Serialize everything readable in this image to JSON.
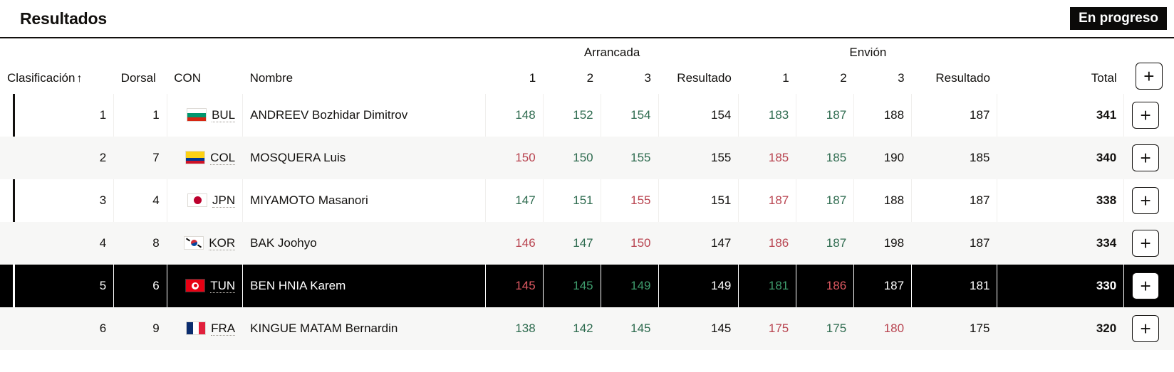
{
  "header": {
    "title": "Resultados",
    "status_badge": "En progreso",
    "badge_bg": "#0b0a09",
    "badge_fg": "#ffffff"
  },
  "table": {
    "groups": {
      "snatch": "Arrancada",
      "cleanjerk": "Envión",
      "total": "Total"
    },
    "columns": {
      "rank": "Clasificación",
      "sort_arrow": "↑",
      "bib": "Dorsal",
      "noc": "CON",
      "name": "Nombre",
      "a1": "1",
      "a2": "2",
      "a3": "3",
      "a_result": "Resultado",
      "c1": "1",
      "c2": "2",
      "c3": "3",
      "c_result": "Resultado",
      "total": "Total",
      "expand": "+"
    },
    "colors": {
      "good": "#2e6b4f",
      "bad": "#b8434f",
      "neutral": "#12100e",
      "selected_bg": "#000000",
      "row_alt_bg": "#f7f7f6"
    },
    "rows": [
      {
        "rank": "1",
        "bib": "1",
        "noc": "BUL",
        "flag": "flag-bulgaria",
        "name": "ANDREEV Bozhidar Dimitrov",
        "a1": "148",
        "a1_state": "good",
        "a2": "152",
        "a2_state": "good",
        "a3": "154",
        "a3_state": "good",
        "a_result": "154",
        "c1": "183",
        "c1_state": "good",
        "c2": "187",
        "c2_state": "good",
        "c3": "188",
        "c3_state": "pending",
        "c_result": "187",
        "total": "341",
        "expand": "+",
        "selected": false,
        "accent": true
      },
      {
        "rank": "2",
        "bib": "7",
        "noc": "COL",
        "flag": "flag-colombia",
        "name": "MOSQUERA Luis",
        "a1": "150",
        "a1_state": "bad",
        "a2": "150",
        "a2_state": "good",
        "a3": "155",
        "a3_state": "good",
        "a_result": "155",
        "c1": "185",
        "c1_state": "bad",
        "c2": "185",
        "c2_state": "good",
        "c3": "190",
        "c3_state": "pending",
        "c_result": "185",
        "total": "340",
        "expand": "+",
        "selected": false,
        "accent": false
      },
      {
        "rank": "3",
        "bib": "4",
        "noc": "JPN",
        "flag": "flag-japan",
        "name": "MIYAMOTO Masanori",
        "a1": "147",
        "a1_state": "good",
        "a2": "151",
        "a2_state": "good",
        "a3": "155",
        "a3_state": "bad",
        "a_result": "151",
        "c1": "187",
        "c1_state": "bad",
        "c2": "187",
        "c2_state": "good",
        "c3": "188",
        "c3_state": "pending",
        "c_result": "187",
        "total": "338",
        "expand": "+",
        "selected": false,
        "accent": true
      },
      {
        "rank": "4",
        "bib": "8",
        "noc": "KOR",
        "flag": "flag-korea",
        "name": "BAK Joohyo",
        "a1": "146",
        "a1_state": "bad",
        "a2": "147",
        "a2_state": "good",
        "a3": "150",
        "a3_state": "bad",
        "a_result": "147",
        "c1": "186",
        "c1_state": "bad",
        "c2": "187",
        "c2_state": "good",
        "c3": "198",
        "c3_state": "pending",
        "c_result": "187",
        "total": "334",
        "expand": "+",
        "selected": false,
        "accent": false
      },
      {
        "rank": "5",
        "bib": "6",
        "noc": "TUN",
        "flag": "flag-tunisia",
        "name": "BEN HNIA Karem",
        "a1": "145",
        "a1_state": "bad",
        "a2": "145",
        "a2_state": "good",
        "a3": "149",
        "a3_state": "good",
        "a_result": "149",
        "c1": "181",
        "c1_state": "good",
        "c2": "186",
        "c2_state": "bad",
        "c3": "187",
        "c3_state": "pending",
        "c_result": "181",
        "total": "330",
        "expand": "+",
        "selected": true,
        "accent": false
      },
      {
        "rank": "6",
        "bib": "9",
        "noc": "FRA",
        "flag": "flag-france",
        "name": "KINGUE MATAM Bernardin",
        "a1": "138",
        "a1_state": "good",
        "a2": "142",
        "a2_state": "good",
        "a3": "145",
        "a3_state": "good",
        "a_result": "145",
        "c1": "175",
        "c1_state": "bad",
        "c2": "175",
        "c2_state": "good",
        "c3": "180",
        "c3_state": "bad",
        "c_result": "175",
        "total": "320",
        "expand": "+",
        "selected": false,
        "accent": false
      }
    ]
  }
}
